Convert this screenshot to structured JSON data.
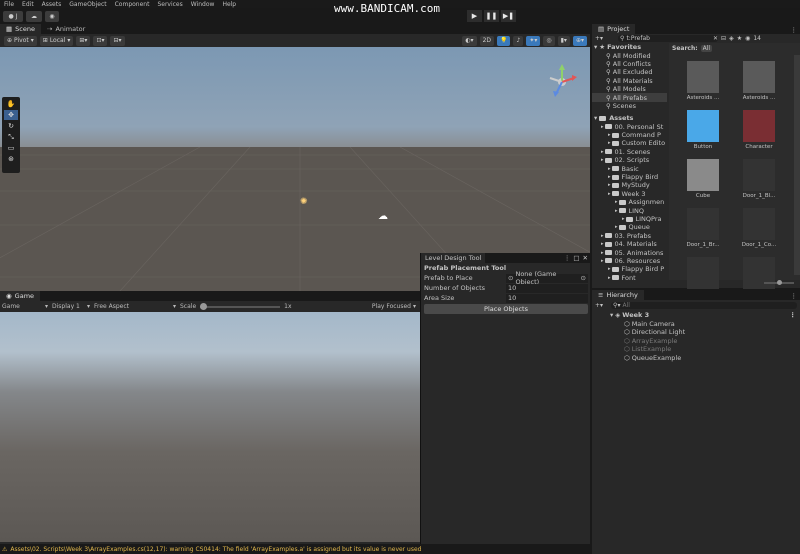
{
  "menu": [
    "File",
    "Edit",
    "Assets",
    "GameObject",
    "Component",
    "Services",
    "Window",
    "Help"
  ],
  "watermark": "www.BANDICAM.com",
  "account_label": "J",
  "scene_tabs": [
    "Scene",
    "Animator"
  ],
  "scene_toolbar": {
    "pivot": "Pivot",
    "local": "Local",
    "mode_2d": "2D"
  },
  "game_tab": "Game",
  "game_toolbar": {
    "view": "Game",
    "display": "Display 1",
    "aspect": "Free Aspect",
    "scale_label": "Scale",
    "scale_value": "1x",
    "play_focused": "Play Focused"
  },
  "level_design": {
    "tab": "Level Design Tool",
    "header": "Prefab Placement Tool",
    "fields": [
      {
        "label": "Prefab to Place",
        "value": "None (Game Object)"
      },
      {
        "label": "Number of Objects",
        "value": "10"
      },
      {
        "label": "Area Size",
        "value": "10"
      }
    ],
    "button": "Place Objects"
  },
  "project": {
    "tab": "Project",
    "search_value": "t:Prefab",
    "search_label": "Search:",
    "search_scope": "All",
    "item_count": "14",
    "favorites_label": "Favorites",
    "favorites": [
      "All Modified",
      "All Conflicts",
      "All Excluded",
      "All Materials",
      "All Models",
      "All Prefabs",
      "Scenes"
    ],
    "assets_label": "Assets",
    "tree": [
      {
        "label": "00. Personal St",
        "indent": 1
      },
      {
        "label": "Command P",
        "indent": 2
      },
      {
        "label": "Custom Edito",
        "indent": 2
      },
      {
        "label": "01. Scenes",
        "indent": 1
      },
      {
        "label": "02. Scripts",
        "indent": 1
      },
      {
        "label": "Basic",
        "indent": 2
      },
      {
        "label": "Flappy Bird",
        "indent": 2
      },
      {
        "label": "MyStudy",
        "indent": 2
      },
      {
        "label": "Week 3",
        "indent": 2
      },
      {
        "label": "Assignmen",
        "indent": 3
      },
      {
        "label": "LINQ",
        "indent": 3
      },
      {
        "label": "LINQPra",
        "indent": 4
      },
      {
        "label": "Queue",
        "indent": 3
      },
      {
        "label": "03. Prefabs",
        "indent": 1
      },
      {
        "label": "04. Materials",
        "indent": 1
      },
      {
        "label": "05. Animations",
        "indent": 1
      },
      {
        "label": "06. Resources",
        "indent": 1
      },
      {
        "label": "Flappy Bird P",
        "indent": 2
      },
      {
        "label": "Font",
        "indent": 2
      }
    ],
    "grid_items": [
      {
        "label": "Asteroids ...",
        "thumb": "#5a5a5a"
      },
      {
        "label": "Asteroids ...",
        "thumb": "#5a5a5a"
      },
      {
        "label": "Button",
        "thumb": "#4aa8e8"
      },
      {
        "label": "Character",
        "thumb": "#7a2e33"
      },
      {
        "label": "Cube",
        "thumb": "#8a8a8a"
      },
      {
        "label": "Door_1_Bl...",
        "thumb": "#333333"
      },
      {
        "label": "Door_1_Br...",
        "thumb": "#333333"
      },
      {
        "label": "Door_1_Co...",
        "thumb": "#333333"
      },
      {
        "label": "",
        "thumb": "#333333"
      },
      {
        "label": "",
        "thumb": "#333333"
      }
    ]
  },
  "hierarchy": {
    "tab": "Hierarchy",
    "search_placeholder": "All",
    "scene": "Week 3",
    "items": [
      {
        "label": "Main Camera",
        "disabled": false
      },
      {
        "label": "Directional Light",
        "disabled": false
      },
      {
        "label": "ArrayExample",
        "disabled": true
      },
      {
        "label": "ListExample",
        "disabled": true
      },
      {
        "label": "QueueExample",
        "disabled": false
      }
    ]
  },
  "status": "Assets\\02. Scripts\\Week 3\\ArrayExamples.cs(12,17): warning CS0414: The field 'ArrayExamples.a' is assigned but its value is never used",
  "colors": {
    "accent": "#3a79bb",
    "warning": "#e2b84c",
    "selection": "#2c5d87"
  }
}
